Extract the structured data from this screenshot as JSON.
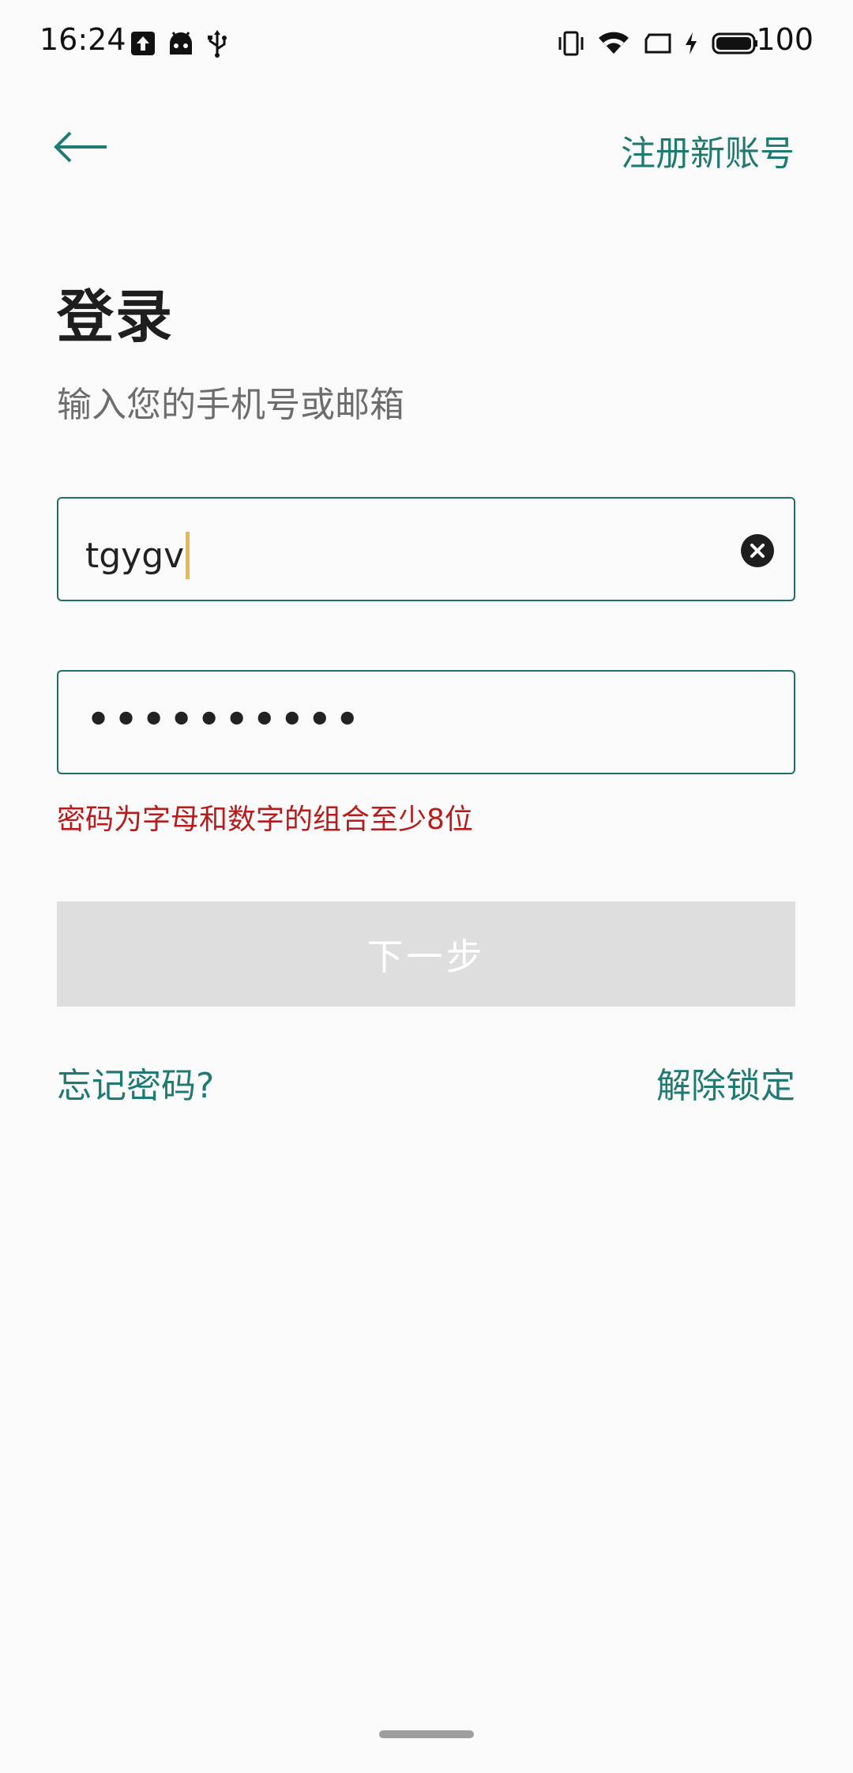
{
  "status_bar": {
    "time": "16:24",
    "battery": "100",
    "icons": [
      "upload-notification-icon",
      "android-icon",
      "usb-icon",
      "vibrate-icon",
      "wifi-icon",
      "screen-rotation-icon",
      "charging-icon",
      "battery-icon"
    ]
  },
  "header": {
    "back_icon": "arrow-left-icon",
    "register_label": "注册新账号"
  },
  "title": "登录",
  "subtitle": "输入您的手机号或邮箱",
  "account_field": {
    "value": "tgygv",
    "clear_icon": "clear-circle-icon"
  },
  "password_field": {
    "masked_value": "••••••••••"
  },
  "error_message": "密码为字母和数字的组合至少8位",
  "next_button_label": "下一步",
  "links": {
    "forgot_password": "忘记密码?",
    "unlock": "解除锁定"
  },
  "colors": {
    "accent": "#1f7a72",
    "error": "#b71c1c",
    "disabled_button": "#dedede",
    "caret": "#e8b84a"
  }
}
